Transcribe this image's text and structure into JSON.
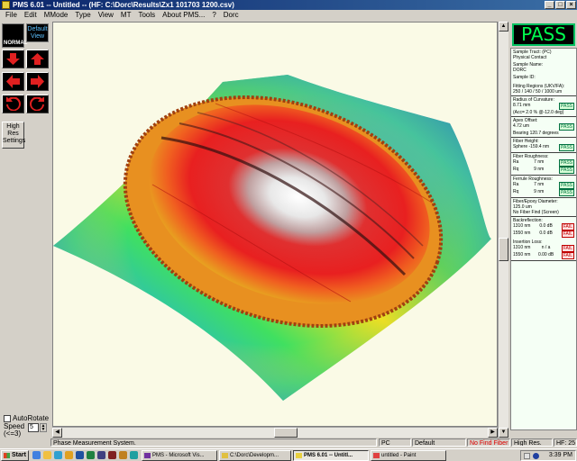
{
  "window": {
    "title": "PMS 6.01 -- Untitled -- (HF: C:\\Dorc\\Results\\Zx1 101703 1200.csv)"
  },
  "menu": [
    "File",
    "Edit",
    "MMode",
    "Type",
    "View",
    "MT",
    "Tools",
    "About PMS...",
    "?",
    "Dorc"
  ],
  "toolbar": {
    "normal_label": "NORMAL",
    "default_view_label": "Default View",
    "high_res_label": "High Res Settings",
    "auto_rotate_label": "AutoRotate",
    "speed_label": "Speed (<=3)",
    "speed_value": "5"
  },
  "result_banner": "PASS",
  "results": {
    "sample_tract_label": "Sample Tract: (PC)",
    "sample_tract_value": "Physical Contact",
    "sample_name_label": "Sample Name:",
    "sample_name_value": "DORC",
    "sample_id_label": "Sample ID:",
    "fitting_label": "Fitting Regions (UKV/FA):",
    "fitting_value": "250 / 140 / 50 / 1000 um",
    "roc_label": "Radius of Curvature:",
    "roc_value": "8.71 mm",
    "roc_status": "PASS",
    "roc_note": "(Acc= 2.0 % @-12.0 deg)",
    "apex_label": "Apex Offset:",
    "apex_value": "4.72 um",
    "apex_status": "PASS",
    "apex_bearing": "Bearing 120.7 degrees",
    "fiber_height_label": "Fiber Height:",
    "fiber_height_value": "Sphere -159.4 nm",
    "fiber_height_status": "PASS",
    "fiber_rough_label": "Fiber Roughness:",
    "fiber_rough_rows": [
      {
        "k": "Ra",
        "v": "7 nm",
        "s": "PASS"
      },
      {
        "k": "Rq",
        "v": "9 nm",
        "s": "PASS"
      }
    ],
    "ferrule_rough_label": "Ferrule Roughness:",
    "ferrule_rough_rows": [
      {
        "k": "Ra",
        "v": "7 nm",
        "s": "PASS"
      },
      {
        "k": "Rq",
        "v": "9 nm",
        "s": "PASS"
      }
    ],
    "epoxy_label": "Fiber/Epoxy Diameter:",
    "epoxy_value": "125.0 um",
    "epoxy_note": "No Fiber Find (Screen)",
    "backref_label": "Backreflection:",
    "backref_rows": [
      {
        "k": "1310 nm",
        "v": "0.0 dB",
        "s": "FAIL"
      },
      {
        "k": "1550 nm",
        "v": "0.0 dB",
        "s": "FAIL"
      }
    ],
    "insertion_label": "Insertion Loss:",
    "insertion_rows": [
      {
        "k": "1310 nm",
        "v": "n / a",
        "s": "FAIL"
      },
      {
        "k": "1550 nm",
        "v": "0.00 dB",
        "s": "FAIL"
      }
    ]
  },
  "statusbar": {
    "message": "Phase Measurement System.",
    "mode": "PC",
    "profile": "Default",
    "fiber": "No Find Fiber",
    "resolution": "High Res.",
    "hf": "HF: 25"
  },
  "taskbar": {
    "start_label": "Start",
    "tasks": [
      "PMS - Microsoft Vis...",
      "C:\\Dorc\\Developm...",
      "PMS 6.01 -- Untitl...",
      "untitled - Paint"
    ],
    "clock": "3:39 PM"
  },
  "colors": {
    "pass": "#00ff50",
    "fail": "#c00000",
    "titlebar": "#0a246a"
  }
}
